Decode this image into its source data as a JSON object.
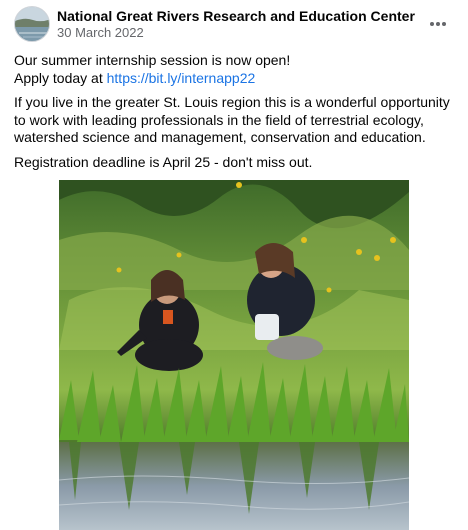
{
  "post": {
    "author": "National Great Rivers Research and Education Center",
    "date": "30 March 2022",
    "more_icon": "more-horizontal-icon",
    "line1": "Our summer internship session is now open!",
    "apply_prefix": "Apply today at ",
    "link": "https://bit.ly/internapp22",
    "paragraph2": "If you live in the greater St. Louis region this is a wonderful opportunity to work with leading professionals in the field of terrestrial ecology, watershed science and management, conservation and education.",
    "paragraph3": "Registration deadline is April 25 - don't miss out."
  },
  "colors": {
    "link": "#1b74e4",
    "secondary_text": "#65676b",
    "primary_text": "#050505"
  }
}
